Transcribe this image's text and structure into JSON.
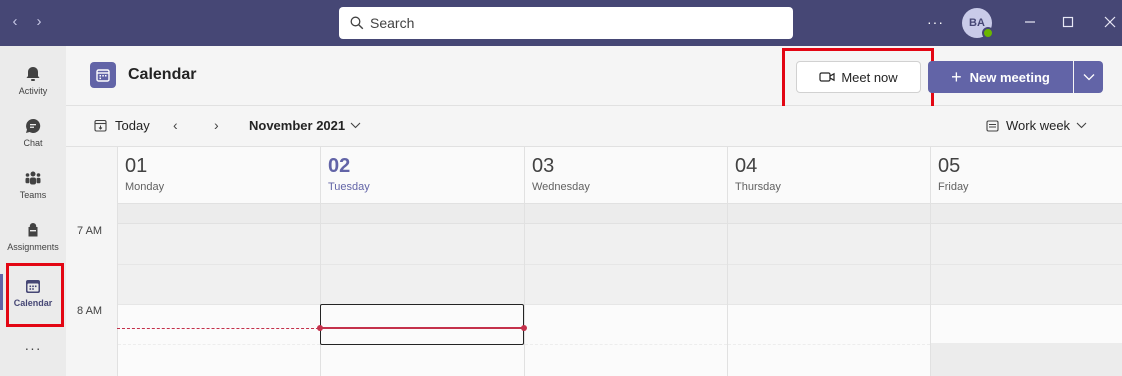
{
  "titlebar": {
    "search_label": "Search",
    "more_label": "···",
    "avatar_initials": "BA",
    "presence_color": "#6bb700",
    "brand_color": "#464775"
  },
  "rail": {
    "items": [
      {
        "label": "Activity",
        "icon": "bell-icon"
      },
      {
        "label": "Chat",
        "icon": "chat-icon"
      },
      {
        "label": "Teams",
        "icon": "teams-icon"
      },
      {
        "label": "Assignments",
        "icon": "assignments-icon"
      },
      {
        "label": "Calendar",
        "icon": "calendar-icon",
        "active": true
      }
    ],
    "more_label": "···"
  },
  "header": {
    "title": "Calendar",
    "meet_now_label": "Meet now",
    "new_meeting_label": "New meeting",
    "accent_color": "#6264a7",
    "highlight_color": "#e30613"
  },
  "toolbar": {
    "today_label": "Today",
    "month_label": "November 2021",
    "view_label": "Work week"
  },
  "grid": {
    "days": [
      {
        "num": "01",
        "name": "Monday"
      },
      {
        "num": "02",
        "name": "Tuesday",
        "today": true
      },
      {
        "num": "03",
        "name": "Wednesday"
      },
      {
        "num": "04",
        "name": "Thursday"
      },
      {
        "num": "05",
        "name": "Friday"
      }
    ],
    "times": [
      "7 AM",
      "8 AM"
    ],
    "now_line_color": "#c4314b"
  }
}
